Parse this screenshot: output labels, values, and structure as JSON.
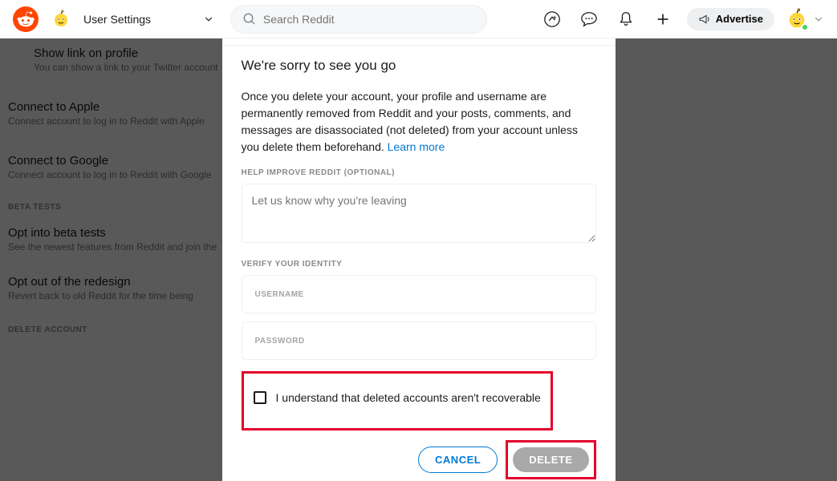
{
  "header": {
    "page_title": "User Settings",
    "search_placeholder": "Search Reddit",
    "advertise_label": "Advertise"
  },
  "settings": {
    "items": [
      {
        "title": "Show link on profile",
        "desc": "You can show a link to your Twitter account"
      },
      {
        "title": "Connect to Apple",
        "desc": "Connect account to log in to Reddit with Apple"
      },
      {
        "title": "Connect to Google",
        "desc": "Connect account to log in to Reddit with Google"
      }
    ],
    "section_beta": "BETA TESTS",
    "beta_items": [
      {
        "title": "Opt into beta tests",
        "desc": "See the newest features from Reddit and join the"
      },
      {
        "title": "Opt out of the redesign",
        "desc": "Revert back to old Reddit for the time being"
      }
    ],
    "section_delete": "DELETE ACCOUNT"
  },
  "modal": {
    "title": "We're sorry to see you go",
    "desc": "Once you delete your account, your profile and username are permanently removed from Reddit and your posts, comments, and messages are disassociated (not deleted) from your account unless you delete them beforehand. ",
    "learn_more": "Learn more",
    "feedback_label": "HELP IMPROVE REDDIT (OPTIONAL)",
    "reason_placeholder": "Let us know why you're leaving",
    "verify_label": "VERIFY YOUR IDENTITY",
    "username_placeholder": "USERNAME",
    "password_placeholder": "PASSWORD",
    "checkbox_label": "I understand that deleted accounts aren't recoverable",
    "cancel_label": "CANCEL",
    "delete_label": "DELETE"
  }
}
